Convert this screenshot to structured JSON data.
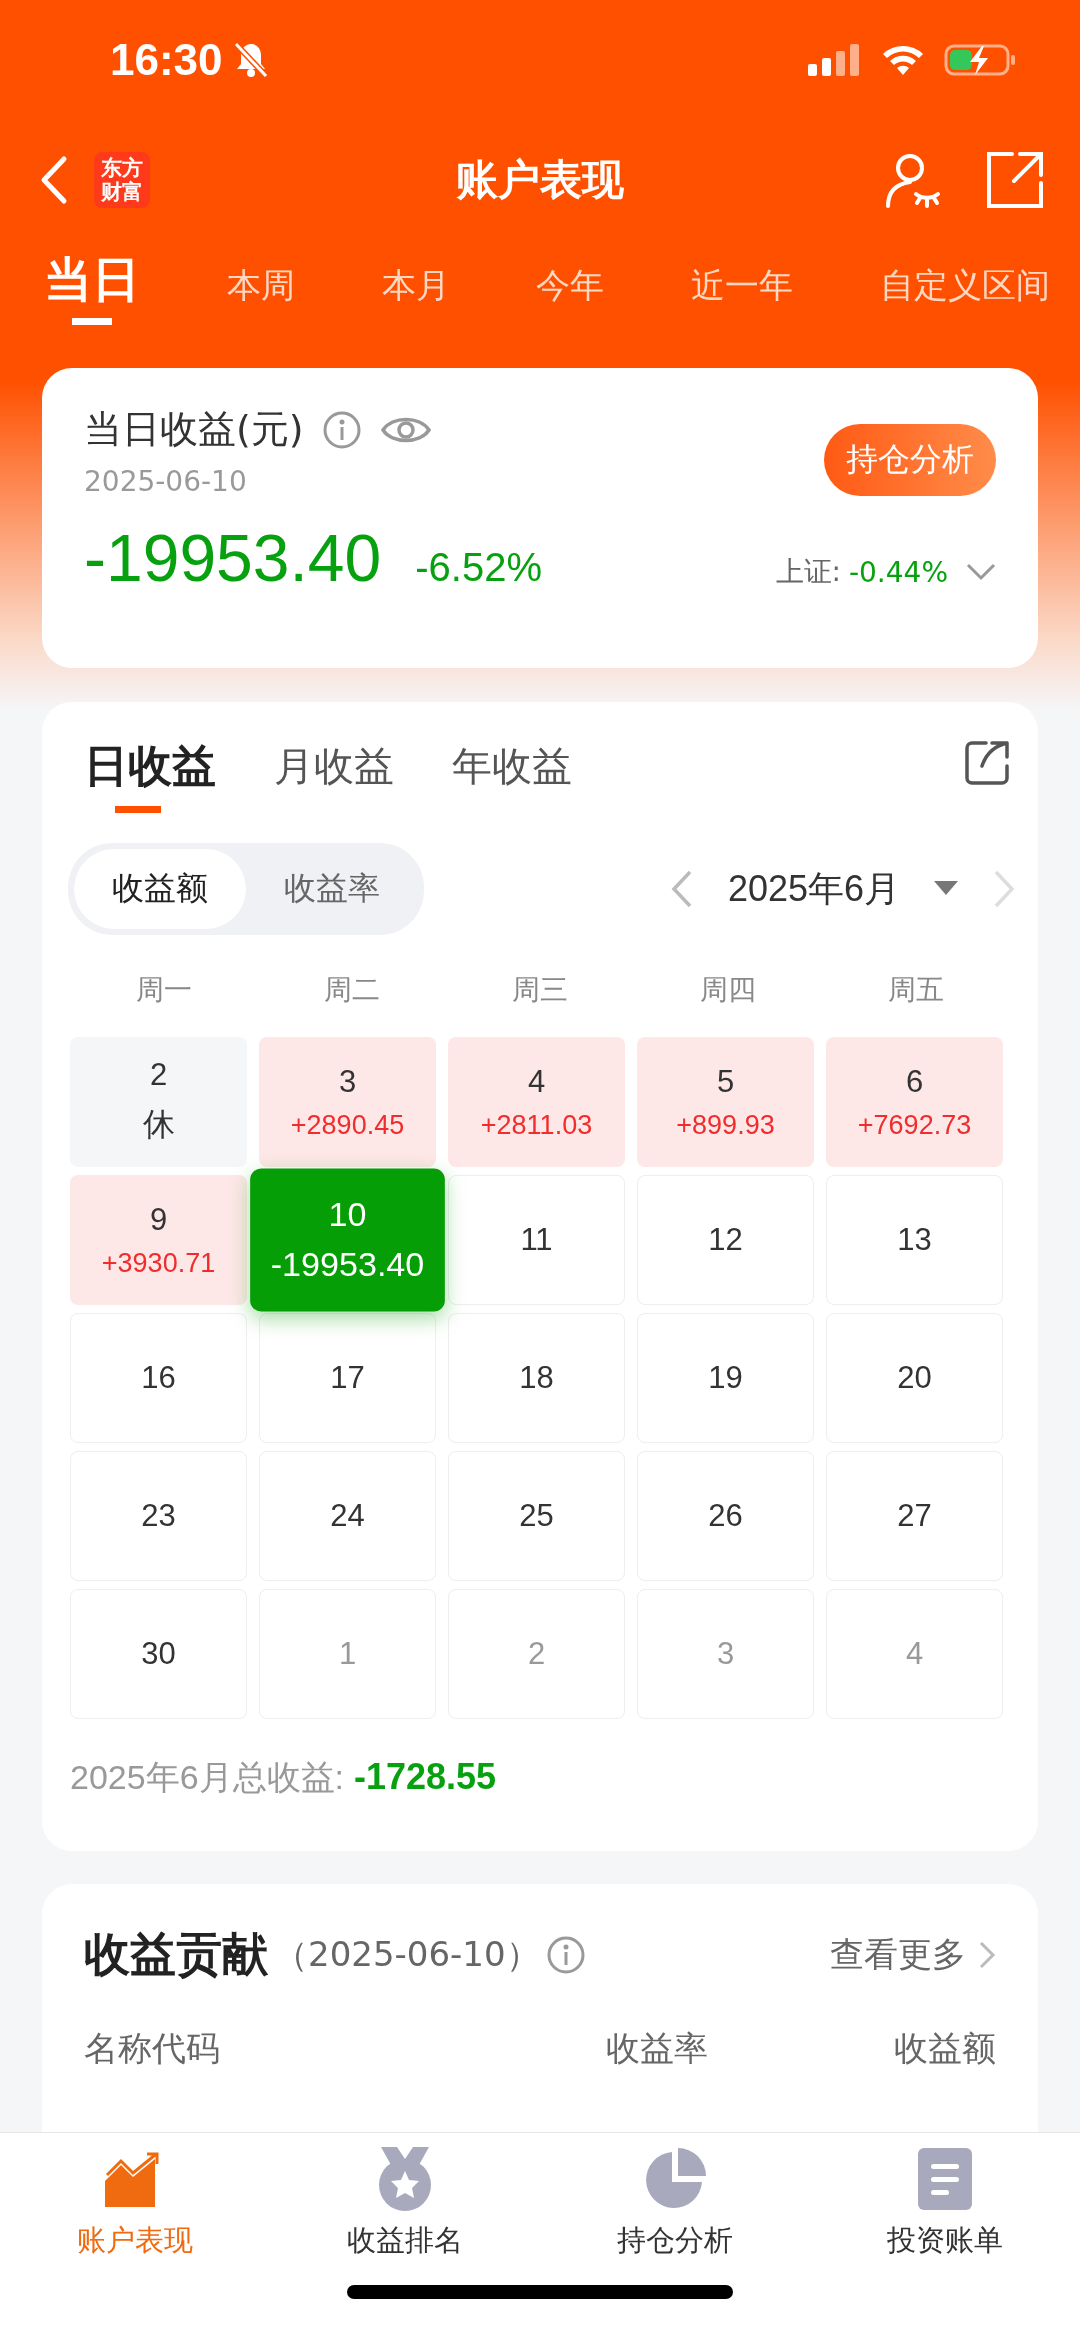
{
  "status_bar": {
    "time": "16:30"
  },
  "nav": {
    "logo": "东方财富",
    "title": "账户表现"
  },
  "period_tabs": [
    {
      "label": "当日",
      "selected": true
    },
    {
      "label": "本周",
      "selected": false
    },
    {
      "label": "本月",
      "selected": false
    },
    {
      "label": "今年",
      "selected": false
    },
    {
      "label": "近一年",
      "selected": false
    },
    {
      "label": "自定义区间",
      "selected": false
    }
  ],
  "summary": {
    "title": "当日收益(元)",
    "date": "2025-06-10",
    "amount": "-19953.40",
    "rate": "-6.52%",
    "button": "持仓分析",
    "index_label": "上证:",
    "index_value": "-0.44%"
  },
  "calendar": {
    "tabs": [
      {
        "label": "日收益",
        "selected": true
      },
      {
        "label": "月收益",
        "selected": false
      },
      {
        "label": "年收益",
        "selected": false
      }
    ],
    "toggle": [
      {
        "label": "收益额",
        "selected": true
      },
      {
        "label": "收益率",
        "selected": false
      }
    ],
    "month": "2025年6月",
    "weekdays": [
      "周一",
      "周二",
      "周三",
      "周四",
      "周五"
    ],
    "cells": [
      {
        "day": "2",
        "value": "休",
        "kind": "rest",
        "selected": false
      },
      {
        "day": "3",
        "value": "+2890.45",
        "kind": "gain",
        "selected": false
      },
      {
        "day": "4",
        "value": "+2811.03",
        "kind": "gain",
        "selected": false
      },
      {
        "day": "5",
        "value": "+899.93",
        "kind": "gain",
        "selected": false
      },
      {
        "day": "6",
        "value": "+7692.73",
        "kind": "gain",
        "selected": false
      },
      {
        "day": "9",
        "value": "+3930.71",
        "kind": "gain",
        "selected": false
      },
      {
        "day": "10",
        "value": "-19953.40",
        "kind": "loss",
        "selected": true
      },
      {
        "day": "11",
        "kind": "plain",
        "selected": false
      },
      {
        "day": "12",
        "kind": "plain",
        "selected": false
      },
      {
        "day": "13",
        "kind": "plain",
        "selected": false
      },
      {
        "day": "16",
        "kind": "plain",
        "selected": false
      },
      {
        "day": "17",
        "kind": "plain",
        "selected": false
      },
      {
        "day": "18",
        "kind": "plain",
        "selected": false
      },
      {
        "day": "19",
        "kind": "plain",
        "selected": false
      },
      {
        "day": "20",
        "kind": "plain",
        "selected": false
      },
      {
        "day": "23",
        "kind": "plain",
        "selected": false
      },
      {
        "day": "24",
        "kind": "plain",
        "selected": false
      },
      {
        "day": "25",
        "kind": "plain",
        "selected": false
      },
      {
        "day": "26",
        "kind": "plain",
        "selected": false
      },
      {
        "day": "27",
        "kind": "plain",
        "selected": false
      },
      {
        "day": "30",
        "kind": "plain",
        "selected": false
      },
      {
        "day": "1",
        "kind": "other",
        "selected": false
      },
      {
        "day": "2",
        "kind": "other",
        "selected": false
      },
      {
        "day": "3",
        "kind": "other",
        "selected": false
      },
      {
        "day": "4",
        "kind": "other",
        "selected": false
      }
    ],
    "total_label": "2025年6月总收益:",
    "total_value": "-1728.55"
  },
  "contribution": {
    "title": "收益贡献",
    "date": "（2025-06-10）",
    "more": "查看更多",
    "columns": [
      "名称代码",
      "收益率",
      "收益额"
    ]
  },
  "bottom_tabs": [
    {
      "label": "账户表现",
      "kind": "chart",
      "selected": true
    },
    {
      "label": "收益排名",
      "kind": "medal",
      "selected": false
    },
    {
      "label": "持仓分析",
      "kind": "pie",
      "selected": false
    },
    {
      "label": "投资账单",
      "kind": "bill",
      "selected": false
    }
  ]
}
